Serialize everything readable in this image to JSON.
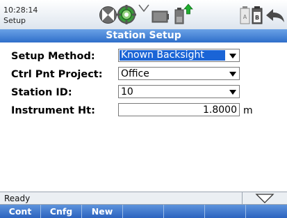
{
  "status_bar": {
    "time": "10:28:14",
    "app_name": "Setup",
    "icons": [
      "compass-icon",
      "target-icon",
      "signal-icon",
      "radio-icon",
      "battery-icon",
      "battery-ab-icon",
      "back-icon"
    ]
  },
  "title": "Station Setup",
  "form": {
    "setup_method": {
      "label": "Setup Method:",
      "value": "Known Backsight"
    },
    "ctrl_project": {
      "label": "Ctrl Pnt Project:",
      "value": "Office"
    },
    "station_id": {
      "label": "Station ID:",
      "value": "10"
    },
    "instrument_ht": {
      "label": "Instrument Ht:",
      "value": "1.8000",
      "unit": "m"
    }
  },
  "status": {
    "text": "Ready"
  },
  "softkeys": [
    "Cont",
    "Cnfg",
    "New",
    "",
    "",
    "",
    ""
  ],
  "colors": {
    "title_blue": "#2f6fca",
    "selection_blue": "#1a64d6",
    "softkey_blue": "#2c63bf"
  }
}
